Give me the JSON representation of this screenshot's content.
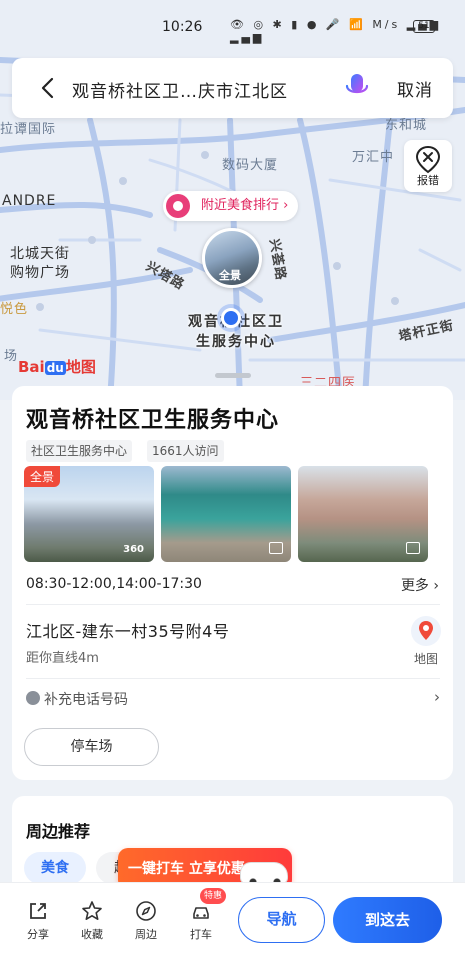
{
  "status_bar": {
    "time": "10:26",
    "icons_text": "M/s",
    "battery": "51"
  },
  "search": {
    "query": "观音桥社区卫…庆市江北区",
    "cancel_label": "取消"
  },
  "map": {
    "error_report_label": "报错",
    "food_rank_label": "附近美食排行 ›",
    "pano_tag": "全景",
    "poi_pin_label": "观音桥社区卫生服务中心",
    "labels": {
      "dongliu": "东和城",
      "shumadaxia": "数码大厦",
      "wanhong": "万汇中",
      "andre": "ANDRE",
      "beichengtianjie": "北城天街",
      "gouwuguangchang": "购物广场",
      "xingnanlu": "兴塔路",
      "xingnanlu2": "兴荟路",
      "tagan": "塔杆正街",
      "guojiguangchang": "拉谭国际",
      "yuese": "悦色",
      "chang": "场",
      "sanhe": "三二四医"
    },
    "logo_bai": "Bai",
    "logo_du": "du",
    "logo_map": "地图",
    "colors": {
      "road": "#a9c2ee",
      "road_major": "#8fb0ea",
      "background": "#e9eef6",
      "accent": "#2e6ff2"
    }
  },
  "poi": {
    "title": "观音桥社区卫生服务中心",
    "tags": [
      "社区卫生服务中心",
      "1661人访问"
    ],
    "photo_pano_tag": "全景",
    "photo_360": "360",
    "hours": "08:30-12:00,14:00-17:30",
    "more_label": "更多 ›",
    "address": "江北区-建东一村35号附4号",
    "distance": "距你直线4m",
    "map_label": "地图",
    "phone_label": "补充电话号码",
    "parking_label": "停车场"
  },
  "nearby": {
    "title": "周边推荐",
    "chips": [
      "美食",
      "超"
    ]
  },
  "taxi_banner": {
    "text": "一键打车 立享优惠"
  },
  "bottom_bar": {
    "share": "分享",
    "favorite": "收藏",
    "nearby": "周边",
    "taxi": "打车",
    "taxi_badge": "特惠",
    "navigate": "导航",
    "go_here": "到这去"
  }
}
